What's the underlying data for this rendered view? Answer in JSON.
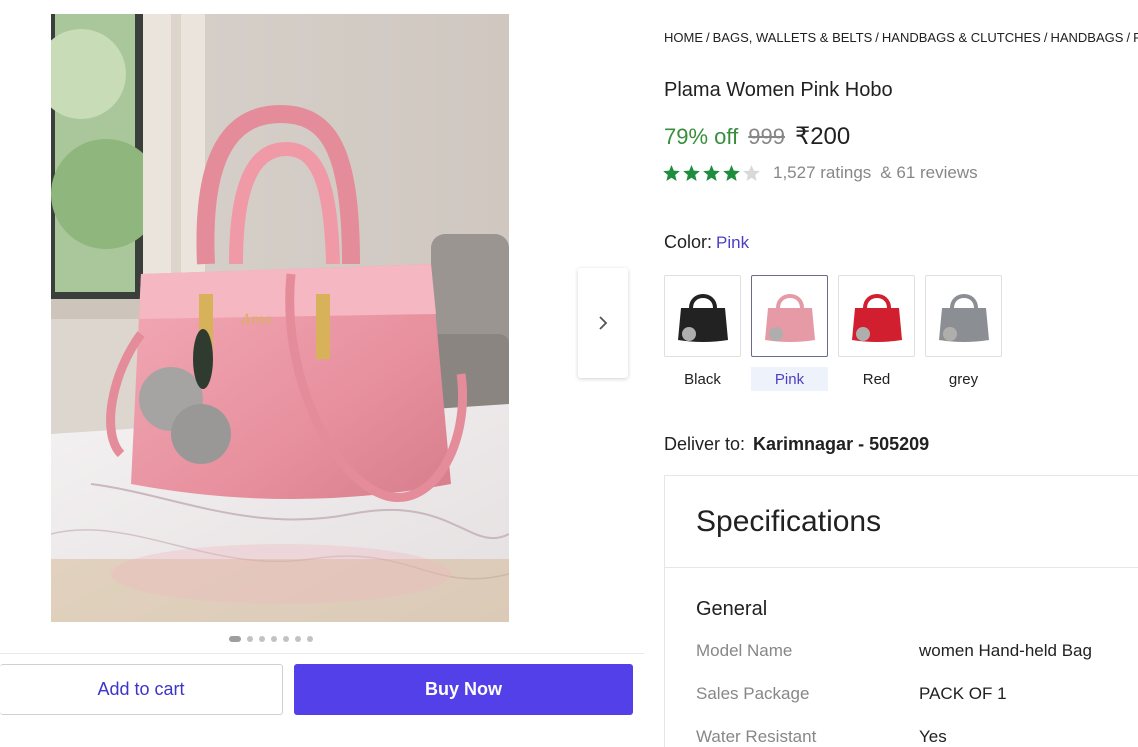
{
  "breadcrumb": [
    "HOME",
    "BAGS, WALLETS & BELTS",
    "HANDBAGS & CLUTCHES",
    "HANDBAGS",
    "PLAMA HANDBAGS"
  ],
  "product": {
    "title": "Plama Women Pink Hobo",
    "discount": "79% off",
    "mrp": "999",
    "price": "₹200",
    "rating_stars": 4,
    "ratings_text": "1,527 ratings",
    "reviews_text": "& 61 reviews",
    "star_color": "#1e8e3e"
  },
  "gallery": {
    "image_count": 7,
    "active_index": 0
  },
  "color": {
    "label": "Color:",
    "selected": "Pink",
    "options": [
      {
        "name": "Black",
        "hex": "#222222",
        "selected": false
      },
      {
        "name": "Pink",
        "hex": "#e59aa5",
        "selected": true
      },
      {
        "name": "Red",
        "hex": "#d11f2f",
        "selected": false
      },
      {
        "name": "grey",
        "hex": "#8b8f94",
        "selected": false
      }
    ]
  },
  "delivery": {
    "label": "Deliver to:",
    "location": "Karimnagar - 505209"
  },
  "actions": {
    "add_to_cart": "Add to cart",
    "buy_now": "Buy Now",
    "accent": "#5340e8"
  },
  "specifications": {
    "heading": "Specifications",
    "group": "General",
    "rows": [
      {
        "key": "Model Name",
        "value": "women Hand-held Bag"
      },
      {
        "key": "Sales Package",
        "value": "PACK OF 1"
      },
      {
        "key": "Water Resistant",
        "value": "Yes"
      }
    ]
  },
  "icons": {
    "next": "chevron-right-icon",
    "star": "star-icon"
  }
}
